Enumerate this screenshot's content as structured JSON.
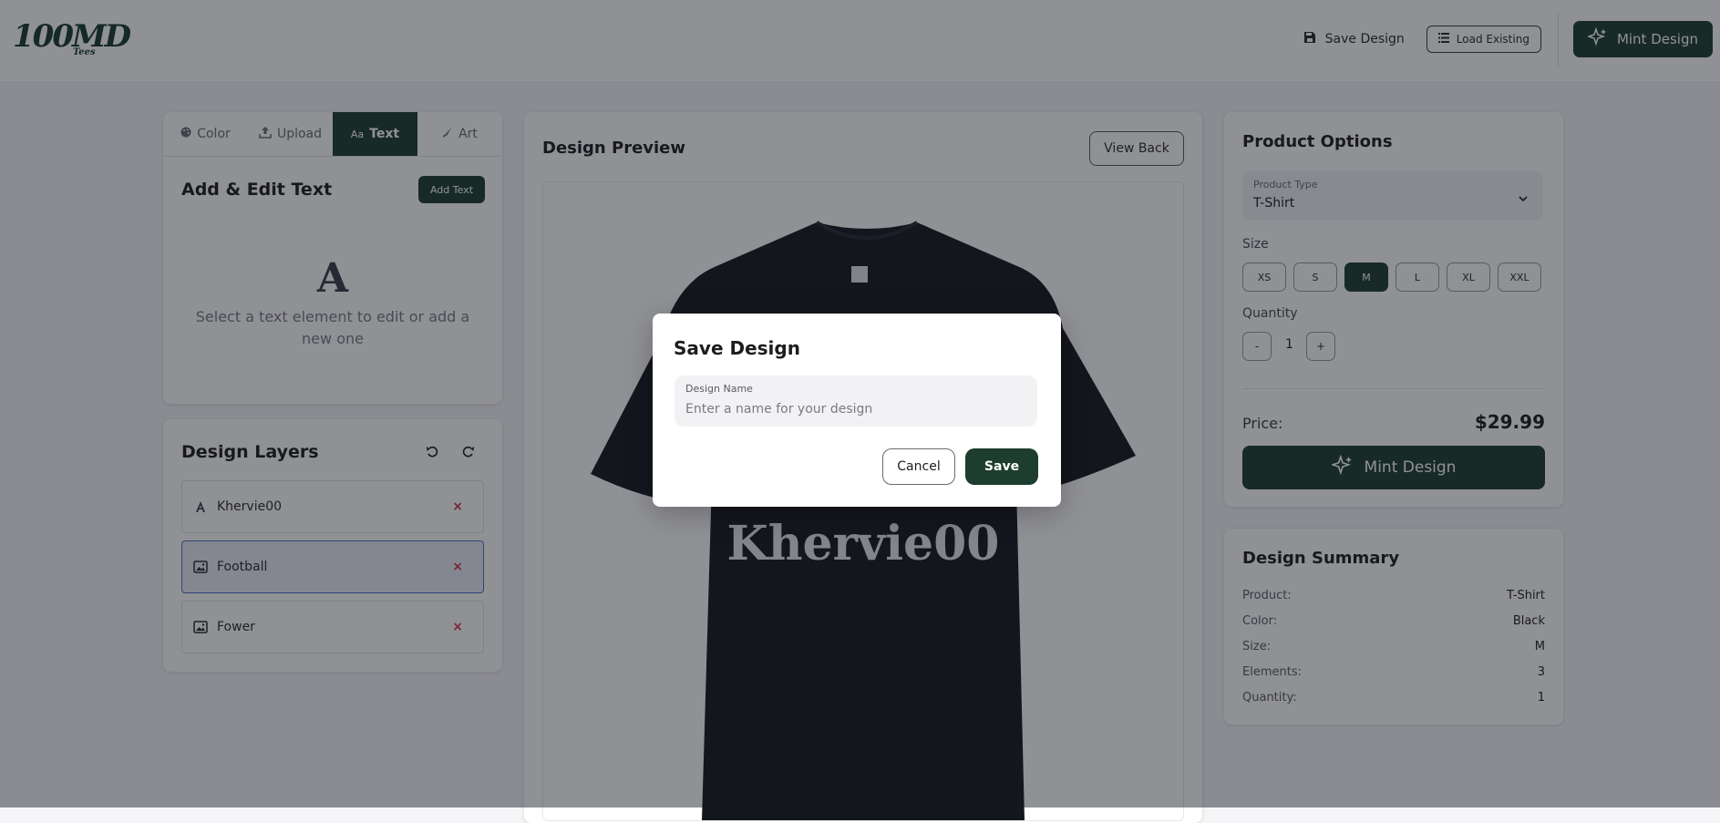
{
  "brand": {
    "logo_big": "100MD",
    "logo_small": "Tees"
  },
  "header": {
    "save_design": "Save Design",
    "load_existing": "Load Existing",
    "mint_design": "Mint Design"
  },
  "tools": {
    "tabs": [
      {
        "label": "Color",
        "icon": "palette-icon",
        "active": false
      },
      {
        "label": "Upload",
        "icon": "upload-icon",
        "active": false
      },
      {
        "label": "Text",
        "icon": "text-icon",
        "active": true
      },
      {
        "label": "Art",
        "icon": "art-icon",
        "active": false
      }
    ],
    "text_tab_icon_glyph": "Aa",
    "title": "Add & Edit Text",
    "add_text": "Add Text",
    "empty_glyph": "A",
    "empty_message": "Select a text element to edit or add a new one"
  },
  "layers": {
    "title": "Design Layers",
    "items": [
      {
        "name": "Khervie00",
        "type": "text",
        "selected": false
      },
      {
        "name": "Football",
        "type": "image",
        "selected": true
      },
      {
        "name": "Fower",
        "type": "image",
        "selected": false
      }
    ],
    "remove_glyph": "×"
  },
  "preview": {
    "title": "Design Preview",
    "view_back": "View Back",
    "shirt_text": "Khervie00"
  },
  "product": {
    "title": "Product Options",
    "type_label": "Product Type",
    "type_value": "T-Shirt",
    "size_label": "Size",
    "sizes": [
      "XS",
      "S",
      "M",
      "L",
      "XL",
      "XXL"
    ],
    "selected_size": "M",
    "quantity_label": "Quantity",
    "qty_minus": "-",
    "quantity": "1",
    "qty_plus": "+",
    "price_label": "Price:",
    "price": "$29.99",
    "mint_design": "Mint Design"
  },
  "summary": {
    "title": "Design Summary",
    "rows": [
      {
        "k": "Product:",
        "v": "T-Shirt"
      },
      {
        "k": "Color:",
        "v": "Black"
      },
      {
        "k": "Size:",
        "v": "M"
      },
      {
        "k": "Elements:",
        "v": "3"
      },
      {
        "k": "Quantity:",
        "v": "1"
      }
    ]
  },
  "modal": {
    "title": "Save Design",
    "field_label": "Design Name",
    "placeholder": "Enter a name for your design",
    "value": "",
    "cancel": "Cancel",
    "save": "Save"
  },
  "colors": {
    "brand_green": "#1d3d2e",
    "remove_red": "#d0344a",
    "selected_blue": "#4a72c4",
    "shirt": "#15171e"
  }
}
